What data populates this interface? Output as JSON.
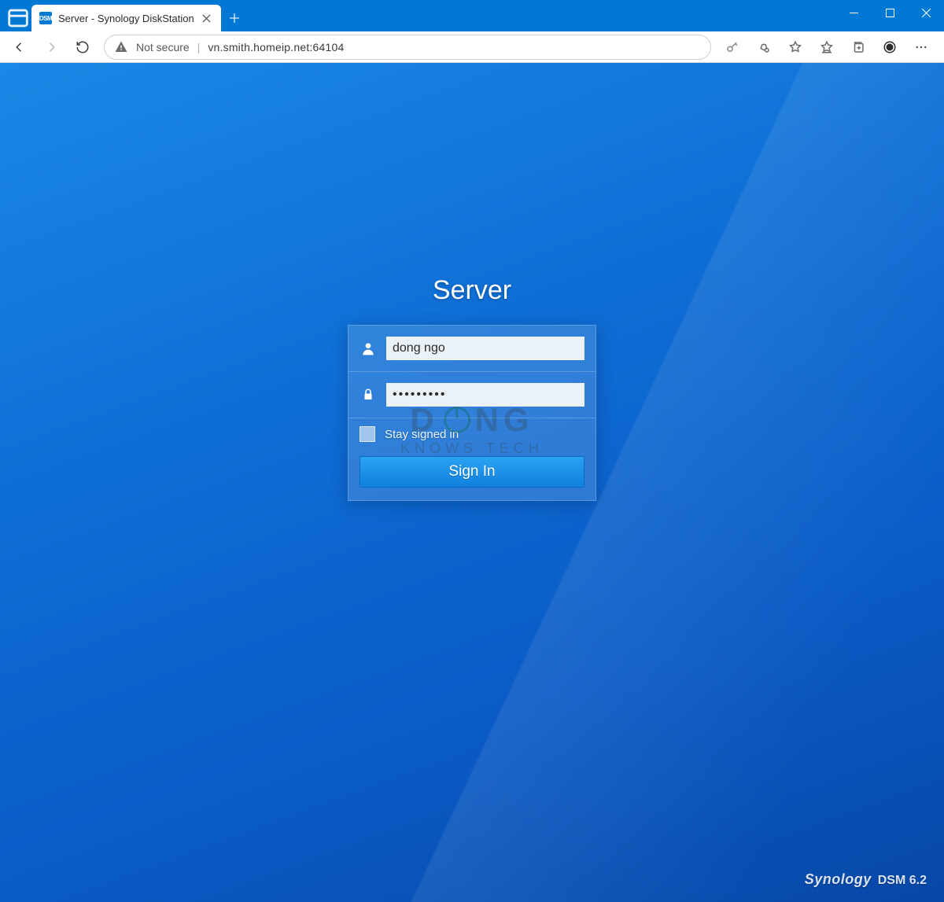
{
  "browser": {
    "tab": {
      "favicon_text": "DSM",
      "title": "Server - Synology DiskStation"
    },
    "addr": {
      "security_label": "Not secure",
      "url_display": "vn.smith.homeip.net:64104"
    }
  },
  "login": {
    "title": "Server",
    "username_value": "dong ngo",
    "password_value": "•••••••••",
    "stay_label": "Stay signed in",
    "signin_label": "Sign In"
  },
  "watermark": {
    "line1_left": "D",
    "line1_right": "NG",
    "line2": "KNOWS TECH"
  },
  "brand": {
    "vendor": "Synology",
    "product": "DSM 6.2"
  }
}
